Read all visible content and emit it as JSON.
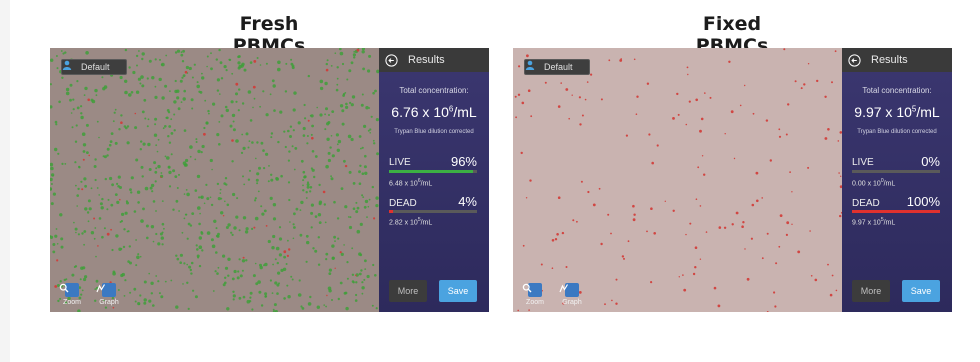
{
  "panels": [
    {
      "title": "Fresh PBMCs",
      "user_label": "Default",
      "tools": {
        "zoom": "Zoom",
        "graph": "Graph"
      },
      "results": {
        "header": "Results",
        "total_label": "Total concentration:",
        "total_value_base": "6.76 x 10",
        "total_value_exp": "6",
        "total_value_unit": "/mL",
        "correction_note": "Trypan Blue dilution corrected",
        "live": {
          "label": "LIVE",
          "percent_text": "96%",
          "fraction": 0.96,
          "conc_base": "6.48 x 10",
          "conc_exp": "6",
          "conc_unit": "/mL"
        },
        "dead": {
          "label": "DEAD",
          "percent_text": "4%",
          "fraction": 0.04,
          "conc_base": "2.82 x 10",
          "conc_exp": "5",
          "conc_unit": "/mL"
        },
        "more_label": "More",
        "save_label": "Save"
      }
    },
    {
      "title": "Fixed PBMCs",
      "user_label": "Default",
      "tools": {
        "zoom": "Zoom",
        "graph": "Graph"
      },
      "results": {
        "header": "Results",
        "total_label": "Total concentration:",
        "total_value_base": "9.97 x 10",
        "total_value_exp": "5",
        "total_value_unit": "/mL",
        "correction_note": "Trypan Blue dilution corrected",
        "live": {
          "label": "LIVE",
          "percent_text": "0%",
          "fraction": 0.0,
          "conc_base": "0.00 x 10",
          "conc_exp": "0",
          "conc_unit": "/mL"
        },
        "dead": {
          "label": "DEAD",
          "percent_text": "100%",
          "fraction": 1.0,
          "conc_base": "9.97 x 10",
          "conc_exp": "5",
          "conc_unit": "/mL"
        },
        "more_label": "More",
        "save_label": "Save"
      }
    }
  ],
  "colors": {
    "live_bar": "#3cb043",
    "dead_bar": "#e0312e",
    "fresh_background": "#9b8a85",
    "fixed_background": "#c9b3b0",
    "live_cell": "#3f9f3a",
    "dead_cell": "#d23a36"
  },
  "icons": [
    "user-icon",
    "back-arrow-icon",
    "zoom-icon",
    "graph-icon"
  ]
}
